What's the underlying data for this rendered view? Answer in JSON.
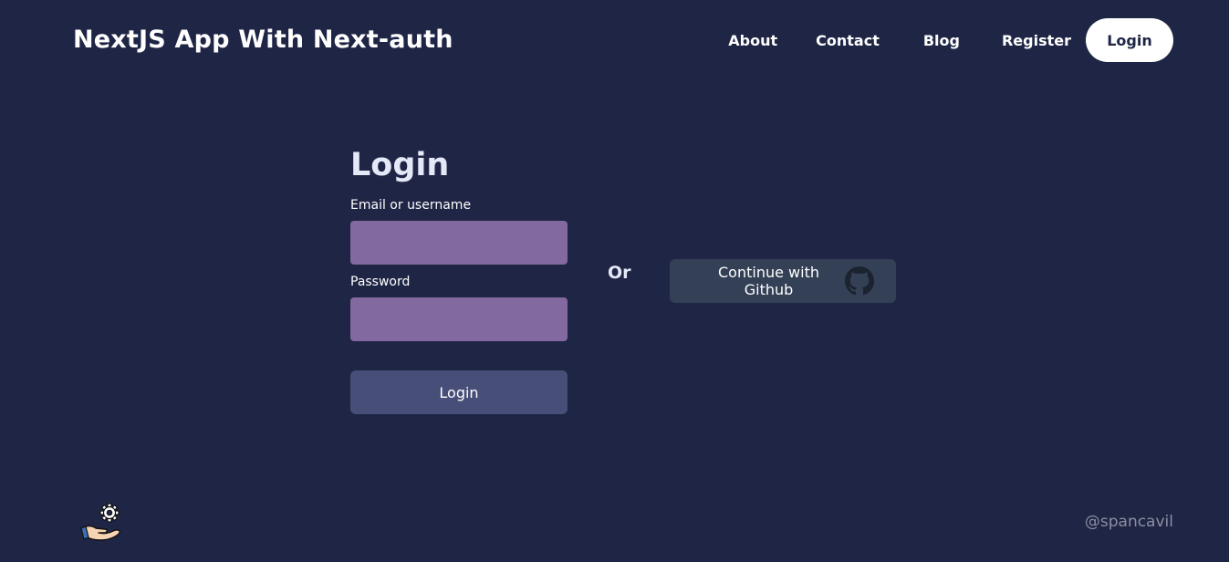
{
  "header": {
    "app_title": "NextJS App With Next-auth",
    "nav": {
      "about": "About",
      "contact": "Contact",
      "blog": "Blog",
      "register": "Register",
      "login": "Login"
    }
  },
  "login_form": {
    "heading": "Login",
    "email_label": "Email or username",
    "email_value": "",
    "password_label": "Password",
    "password_value": "",
    "submit_label": "Login"
  },
  "divider": "Or",
  "github_button": {
    "label": "Continue with Github",
    "icon": "github-icon"
  },
  "footer": {
    "logo_icon": "hand-gear-icon",
    "credit": "@spancavil"
  },
  "colors": {
    "background": "#1f2545",
    "input": "#8269a0",
    "submit": "#474e78",
    "github": "#334056",
    "nav_login_bg": "#ffffff"
  }
}
